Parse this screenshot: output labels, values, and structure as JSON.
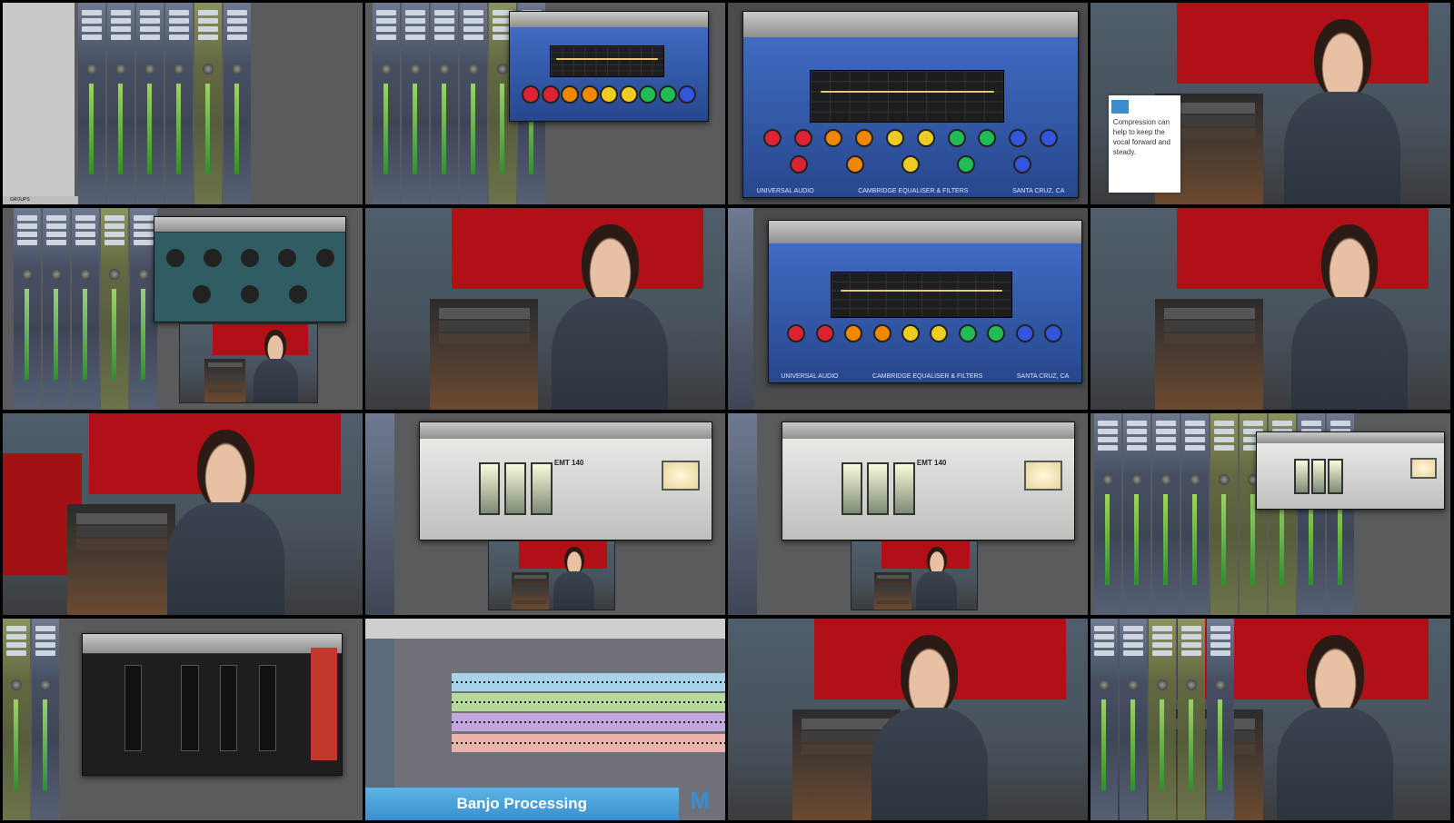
{
  "grid": {
    "rows": 4,
    "cols": 4
  },
  "frames": [
    {
      "id": "r1c1",
      "type": "mixer",
      "label": "GROUPS"
    },
    {
      "id": "r1c2",
      "type": "mixer-eq-small"
    },
    {
      "id": "r1c3",
      "type": "eq-large",
      "left_brand": "UNIVERSAL AUDIO",
      "center_brand": "CAMBRIDGE EQUALISER & FILTERS",
      "right_brand": "SANTA CRUZ, CA"
    },
    {
      "id": "r1c4",
      "type": "person-caption",
      "caption": "Compression can help to keep the vocal forward and steady."
    },
    {
      "id": "r2c1",
      "type": "mixer-plugin-thumb"
    },
    {
      "id": "r2c2",
      "type": "person"
    },
    {
      "id": "r2c3",
      "type": "eq-medium",
      "left_brand": "UNIVERSAL AUDIO",
      "center_brand": "CAMBRIDGE EQUALISER & FILTERS",
      "right_brand": "SANTA CRUZ, CA"
    },
    {
      "id": "r2c4",
      "type": "person"
    },
    {
      "id": "r3c1",
      "type": "person"
    },
    {
      "id": "r3c2",
      "type": "emt-reverb",
      "plugin_name": "EMT 140"
    },
    {
      "id": "r3c3",
      "type": "emt-reverb",
      "plugin_name": "EMT 140"
    },
    {
      "id": "r3c4",
      "type": "mixer-emt"
    },
    {
      "id": "r4c1",
      "type": "mixer-comp"
    },
    {
      "id": "r4c2",
      "type": "edit-window",
      "banner": "Banjo Processing"
    },
    {
      "id": "r4c3",
      "type": "person"
    },
    {
      "id": "r4c4",
      "type": "mixer-person"
    }
  ],
  "colors": {
    "eq_blue": "#2e56a8",
    "studio_red": "#b11116",
    "banner_blue": "#3a8fcf",
    "workspace_gray": "#5a5b5d"
  },
  "icons": {
    "brand_logo": "m-logo-icon"
  }
}
